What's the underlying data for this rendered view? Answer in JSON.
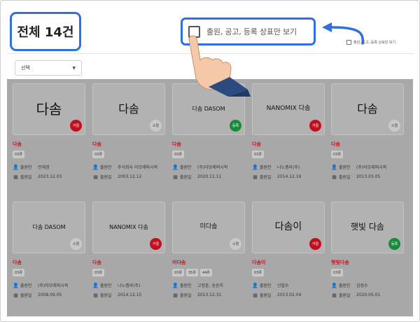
{
  "header": {
    "total_label": "전체 14건",
    "filter_label": "출원, 공고, 등록 상표만 보기",
    "filter_label_small": "출원, 공고, 등록 상표만 보기"
  },
  "select": {
    "value": "선택"
  },
  "labels": {
    "applicant": "출원인",
    "date": "출원일"
  },
  "colors": {
    "accent": "#2f6fe0",
    "reject": "#c0101f",
    "registered": "#1a8a3a",
    "expired": "#c8c8c8",
    "name": "#d0121e"
  },
  "cards": [
    {
      "logo": "다솜",
      "status": "거절",
      "name": "다솜",
      "classes": [
        "03류"
      ],
      "applicant": "전재경",
      "date": "2023.12.03"
    },
    {
      "logo": "다솜",
      "status": "소멸",
      "name": "다솜",
      "classes": [
        "03류"
      ],
      "applicant": "주식회사 아모레퍼시픽",
      "date": "2003.12.12"
    },
    {
      "logo": "다솜 DASOM",
      "status": "등록",
      "name": "다솜",
      "classes": [
        "03류"
      ],
      "applicant": "(주)아모레퍼시픽",
      "date": "2020.11.11"
    },
    {
      "logo": "NANOMIX 다솜",
      "status": "거절",
      "name": "다솜",
      "classes": [
        "03류"
      ],
      "applicant": "나노켐라(주)",
      "date": "2014.12.16"
    },
    {
      "logo": "다솜",
      "status": "소멸",
      "name": "다솜",
      "classes": [
        "03류"
      ],
      "applicant": "(주)아모레퍼시픽",
      "date": "2013.03.05"
    },
    {
      "logo": "다솜 DASOM",
      "status": "소멸",
      "name": "다솜",
      "classes": [
        "03류"
      ],
      "applicant": "(주)아모레퍼시픽",
      "date": "2008.09.05"
    },
    {
      "logo": "NANOMIX 다솜",
      "status": "거절",
      "name": "다솜",
      "classes": [
        "03류"
      ],
      "applicant": "나노켐라(주)",
      "date": "2014.12.15"
    },
    {
      "logo": "미다솜",
      "status": "소멸",
      "name": "미다솜",
      "classes": [
        "03류",
        "35류",
        "44류"
      ],
      "applicant": "고정훈, 송승히",
      "date": "2013.12.31"
    },
    {
      "logo": "다솜이",
      "status": "거절",
      "name": "다솜이",
      "classes": [
        "03류"
      ],
      "applicant": "신필수",
      "date": "2013.02.04"
    },
    {
      "logo": "햇빛 다솜",
      "status": "등록",
      "name": "햇빛다솜",
      "classes": [
        "03류"
      ],
      "applicant": "김정수",
      "date": "2020.05.01"
    }
  ]
}
